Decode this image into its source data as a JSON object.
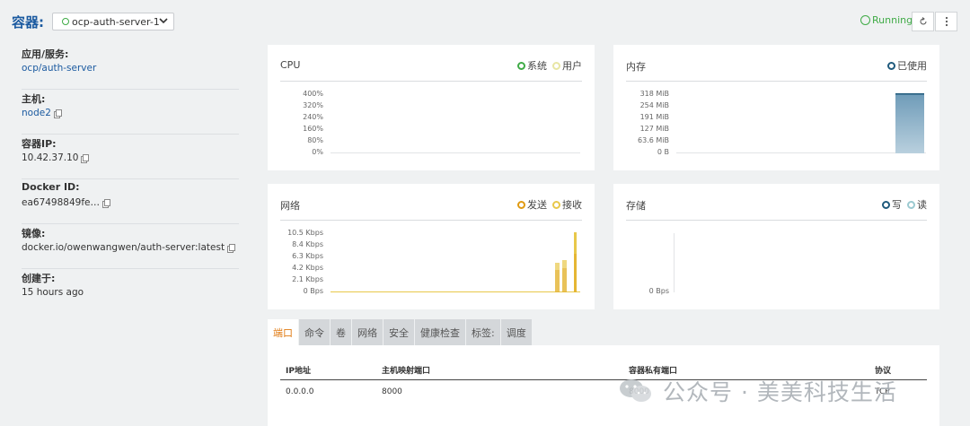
{
  "header": {
    "title": "容器:",
    "container_select": "ocp-auth-server-1",
    "status": "Running",
    "refresh_icon": "refresh-icon",
    "more_icon": "more-vertical-icon"
  },
  "sidebar": {
    "fields": [
      {
        "label": "应用/服务:",
        "value": "ocp/auth-server",
        "link": true,
        "copy": false
      },
      {
        "label": "主机:",
        "value": "node2",
        "link": true,
        "copy": true
      },
      {
        "label": "容器IP:",
        "value": "10.42.37.10",
        "link": false,
        "copy": true
      },
      {
        "label": "Docker ID:",
        "value": "ea67498849fe…",
        "link": false,
        "copy": true
      },
      {
        "label": "镜像:",
        "value": "docker.io/owenwangwen/auth-server:latest",
        "link": false,
        "copy": true
      },
      {
        "label": "创建于:",
        "value": "15 hours ago",
        "link": false,
        "copy": false
      }
    ]
  },
  "cards": {
    "cpu": {
      "title": "CPU",
      "legend": [
        "系统",
        "用户"
      ],
      "ticks": [
        "400%",
        "320%",
        "240%",
        "160%",
        "80%",
        "0%"
      ]
    },
    "memory": {
      "title": "内存",
      "legend": [
        "已使用"
      ],
      "ticks": [
        "318 MiB",
        "254 MiB",
        "191 MiB",
        "127 MiB",
        "63.6 MiB",
        "0 B"
      ]
    },
    "network": {
      "title": "网络",
      "legend": [
        "发送",
        "接收"
      ],
      "ticks": [
        "10.5 Kbps",
        "8.4 Kbps",
        "6.3 Kbps",
        "4.2 Kbps",
        "2.1 Kbps",
        "0 Bps"
      ]
    },
    "storage": {
      "title": "存储",
      "legend": [
        "写",
        "读"
      ],
      "ticks": [
        "0 Bps"
      ]
    }
  },
  "colors": {
    "accent": "#1b5aa0",
    "running": "#3fab46",
    "cpu_system": "#3fab46",
    "cpu_user": "#e8e6a4",
    "memory_used": "#1f5a7c",
    "net_send": "#e09a11",
    "net_recv": "#e8c84a",
    "storage_write": "#1f5a7c",
    "storage_read": "#9ccad1",
    "tab_active": "#e07b13"
  },
  "tabs": [
    "端口",
    "命令",
    "卷",
    "网络",
    "安全",
    "健康检查",
    "标签:",
    "调度"
  ],
  "ports_table": {
    "headers": [
      "IP地址",
      "主机映射端口",
      "容器私有端口",
      "协议"
    ],
    "rows": [
      [
        "0.0.0.0",
        "8000",
        "8000",
        "TCP"
      ]
    ]
  },
  "watermark": "公众号 · 美美科技生活"
}
